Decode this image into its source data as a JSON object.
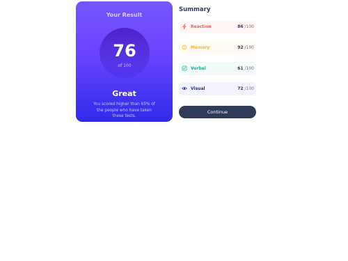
{
  "result": {
    "title": "Your Result",
    "score": "76",
    "out_of": "of 100",
    "rating": "Great",
    "description": "You scored higher than 65% of the people who have taken these tests."
  },
  "summary": {
    "title": "Summary",
    "items": [
      {
        "label": "Reaction",
        "score": "86",
        "max": " /100",
        "icon": "lightning-icon",
        "color": "#ff5757"
      },
      {
        "label": "Memory",
        "score": "92",
        "max": " /100",
        "icon": "brain-icon",
        "color": "#ffb01f"
      },
      {
        "label": "Verbal",
        "score": "61",
        "max": " /100",
        "icon": "checkmark-icon",
        "color": "#00bb8f"
      },
      {
        "label": "Visual",
        "score": "72",
        "max": " /100",
        "icon": "eye-icon",
        "color": "#1125d6"
      }
    ],
    "button_label": "Continue"
  }
}
